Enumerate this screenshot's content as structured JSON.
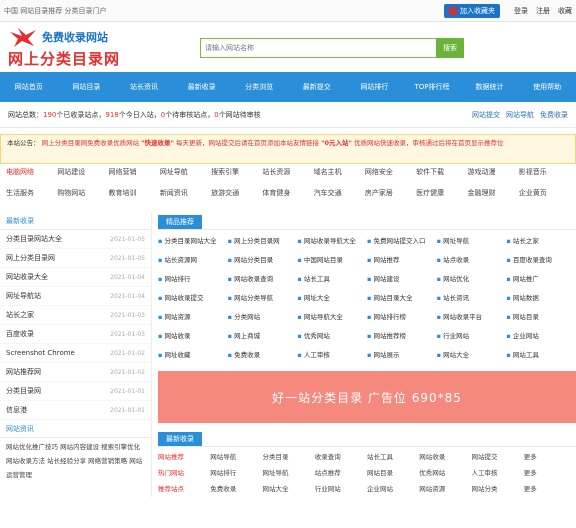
{
  "top": {
    "left": "中国 网站目录推荐 分类目录门户",
    "fav": "加入收藏夹",
    "links": [
      "登录",
      "注册",
      "收藏"
    ]
  },
  "logo": {
    "line1": "免费收录网站",
    "line2": "网上分类目录网"
  },
  "search": {
    "placeholder": "请输入网站名称",
    "button": "搜索"
  },
  "nav": [
    "网站首页",
    "网站目录",
    "站长资讯",
    "最新收录",
    "分类浏览",
    "最新提交",
    "网站排行",
    "TOP排行榜",
    "数据统计",
    "使用帮助"
  ],
  "stats": {
    "prefix": "网站总数：",
    "sites": "190",
    "mid1": "个已收录站点，",
    "ips": "918",
    "mid2": "个今日入站，",
    "today": "0",
    "mid3": "个待审核站点，",
    "pending": "0",
    "suffix": "个网站待审核",
    "r1": "网站提交",
    "r2": "网站导航",
    "r3": "免费收录"
  },
  "banner": {
    "label": "本站公告：",
    "t1": "网上分类目录网免费收录优质网站",
    "hl1": "\"快速收录\"",
    "t2": "每天更新，网站提交后请在首页添加本站友情链接",
    "hl2": "\"0元入站\"",
    "t3": "优质网站快速收录，审核通过后将在首页显示推荐位"
  },
  "cats": [
    "电脑网络",
    "网站建设",
    "网络营销",
    "网址导航",
    "搜索引擎",
    "站长资源",
    "域名主机",
    "网络安全",
    "软件下载",
    "游戏动漫",
    "影视音乐",
    "生活服务",
    "购物网站",
    "教育培训",
    "新闻资讯",
    "旅游交通",
    "体育健身",
    "汽车交通",
    "房产家居",
    "医疗健康",
    "金融理财",
    "企业黄页"
  ],
  "left1": {
    "title": "最新收录",
    "rows": [
      {
        "name": "分类目录网站大全",
        "date": "2021-01-05"
      },
      {
        "name": "网上分类目录网",
        "date": "2021-01-05"
      },
      {
        "name": "网站收录大全",
        "date": "2021-01-04"
      },
      {
        "name": "网址导航站",
        "date": "2021-01-04"
      },
      {
        "name": "站长之家",
        "date": "2021-01-03"
      },
      {
        "name": "百度收录",
        "date": "2021-01-03"
      },
      {
        "name": "Screenshot Chrome",
        "date": "2021-01-02"
      },
      {
        "name": "网站推荐网",
        "date": "2021-01-02"
      },
      {
        "name": "分类目录网",
        "date": "2021-01-01"
      },
      {
        "name": "信息港",
        "date": "2021-01-01"
      }
    ]
  },
  "left2": {
    "title": "网站资讯",
    "text": "网站优化推广技巧 网站内容建设 搜索引擎优化 网站收录方法 站长经验分享 网络营销策略 网站运营管理"
  },
  "right1": {
    "tab": "精品推荐",
    "items": [
      "分类目录网站大全",
      "网上分类目录网",
      "网站收录导航大全",
      "免费网站提交入口",
      "网址导航",
      "站长之家",
      "站长资源网",
      "网站分类目录",
      "中国网站目录",
      "网站推荐",
      "站点收录",
      "百度收录查询",
      "网站排行",
      "网站收录查询",
      "站长工具",
      "网站建设",
      "网站优化",
      "网站推广",
      "网站收录提交",
      "网站分类导航",
      "网址大全",
      "网站目录大全",
      "站长资讯",
      "网站数据",
      "网站资源",
      "分类网站",
      "网站导航大全",
      "网站排行榜",
      "网站收录平台",
      "网站目录",
      "网站收录",
      "网上商城",
      "优秀网站",
      "网站推荐榜",
      "行业网站",
      "企业网站",
      "网址收藏",
      "免费收录",
      "人工审核",
      "网站展示",
      "网站大全",
      "网站工具"
    ]
  },
  "ad": {
    "text": "好一站分类目录 广告位 690*85"
  },
  "right2": {
    "tab": "最新收录",
    "items": [
      "网站推荐",
      "网站导航",
      "分类目录",
      "收录查询",
      "站长工具",
      "网站收录",
      "网站提交",
      "更多",
      "热门网站",
      "网站排行",
      "网址导航",
      "站点推荐",
      "网站目录",
      "优秀网站",
      "人工审核",
      "更多",
      "推荐站点",
      "免费收录",
      "网站大全",
      "行业网站",
      "企业网站",
      "网站资源",
      "网站分类",
      "更多"
    ]
  }
}
